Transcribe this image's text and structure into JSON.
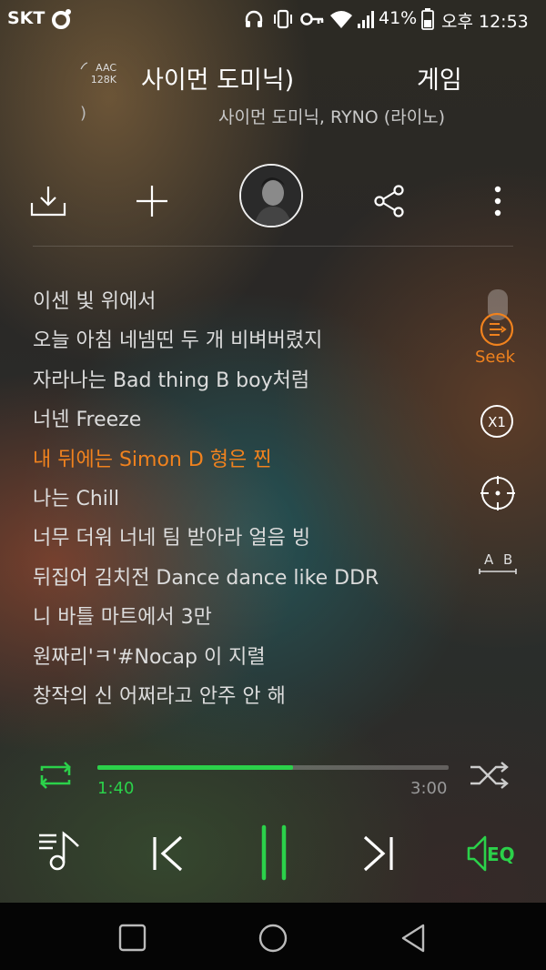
{
  "status_bar": {
    "carrier": "SKT",
    "battery": "41%",
    "time": "오후 12:53",
    "icons": [
      "notification-icon",
      "headphones-icon",
      "vibrate-icon",
      "key-icon",
      "wifi-icon",
      "signal-icon",
      "battery-icon"
    ]
  },
  "header": {
    "audio_format": "AAC",
    "bitrate": "128K",
    "title_scroll": "사이먼 도미닉)",
    "title_next": "게임",
    "artist_left_fragment": ")",
    "artist": "사이먼 도미닉, RYNO (라이노)"
  },
  "actions": [
    "download-icon",
    "add-icon",
    "artist-avatar",
    "share-icon",
    "more-icon"
  ],
  "lyrics": {
    "current_index": 4,
    "lines": [
      "이센 빛 위에서",
      "오늘 아침 네넴띤 두 개 비벼버렸지",
      "자라나는 Bad thing B boy처럼",
      "너넨 Freeze",
      "내 뒤에는 Simon D 형은 찐",
      "나는 Chill",
      "너무 더워 너네 팀 받아라 얼음 빙",
      "뒤집어 김치전 Dance dance like DDR",
      "니 바틀 마트에서 3만",
      "원짜리'ㅋ'#Nocap 이 지렬",
      "창작의 신 어쩌라고 안주 안 해"
    ]
  },
  "tools": {
    "seek_label": "Seek",
    "speed_label": "X1",
    "ab_label": "A B"
  },
  "player": {
    "current_time": "1:40",
    "total_time": "3:00",
    "progress": 0.556
  },
  "colors": {
    "accent_green": "#2bd14a",
    "accent_orange": "#f0821e"
  }
}
